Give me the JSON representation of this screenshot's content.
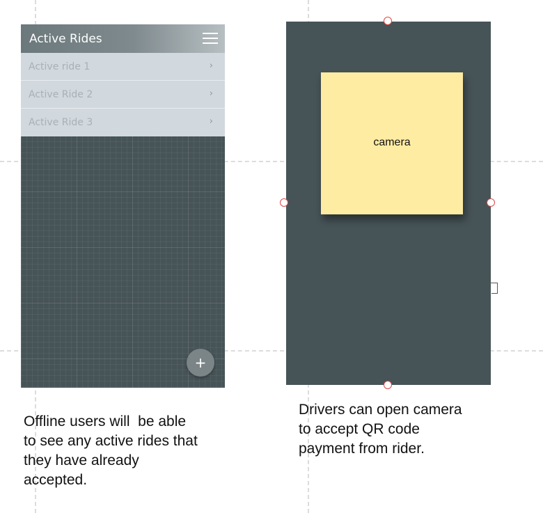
{
  "left_screen": {
    "title": "Active Rides",
    "menu_icon": "hamburger-menu-icon",
    "rides": [
      {
        "label": "Active ride 1",
        "chevron": "›"
      },
      {
        "label": "Active Ride 2",
        "chevron": "›"
      },
      {
        "label": "Active Ride 3",
        "chevron": "›"
      }
    ],
    "fab_label": "+",
    "colors": {
      "background": "#465357",
      "appbar": "#7f8a8e",
      "row": "#d1d8de"
    }
  },
  "right_screen": {
    "camera_label": "camera",
    "colors": {
      "background": "#465357",
      "sticky_note": "#ffeca3",
      "handle_border": "#e04646"
    }
  },
  "captions": {
    "left": "Offline users will  be able\nto see any active rides that\nthey have already\naccepted.",
    "right": "Drivers can open camera\nto accept QR code\npayment from rider."
  }
}
